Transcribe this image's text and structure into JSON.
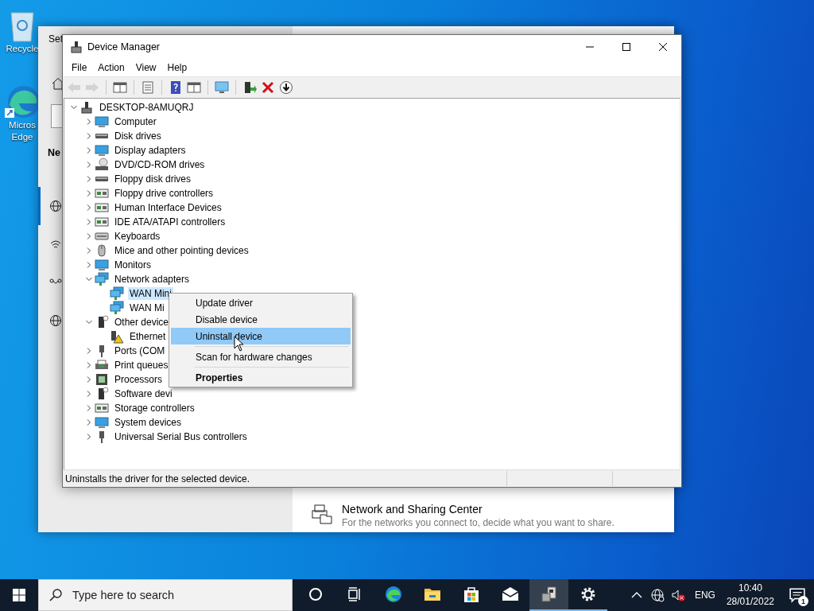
{
  "desktop_icons": [
    {
      "label_lines": [
        "Recycle"
      ]
    },
    {
      "label_lines": [
        "Micros",
        "Edge"
      ]
    }
  ],
  "settings_window": {
    "title": "Set",
    "heading": "Ne",
    "nav_items": [
      {
        "selected": true
      },
      {
        "selected": false
      },
      {
        "selected": false
      },
      {
        "selected": false
      }
    ],
    "link": {
      "title": "Network and Sharing Center",
      "description": "For the networks you connect to, decide what you want to share."
    }
  },
  "device_manager": {
    "title": "Device Manager",
    "menu": [
      "File",
      "Action",
      "View",
      "Help"
    ],
    "toolbar": [
      {
        "disabled": true
      },
      {
        "disabled": true
      },
      {
        "disabled": false
      },
      {
        "disabled": false
      },
      {
        "disabled": false
      },
      {
        "disabled": false
      },
      {
        "disabled": false
      },
      {
        "disabled": false
      },
      {
        "disabled": false
      },
      {
        "disabled": false
      }
    ],
    "tree": {
      "label": "DESKTOP-8AMUQRJ",
      "expanded": true,
      "selected": false,
      "children": [
        {
          "label": "Computer",
          "expanded": false,
          "selected": false
        },
        {
          "label": "Disk drives",
          "expanded": false,
          "selected": false
        },
        {
          "label": "Display adapters",
          "expanded": false,
          "selected": false
        },
        {
          "label": "DVD/CD-ROM drives",
          "expanded": false,
          "selected": false
        },
        {
          "label": "Floppy disk drives",
          "expanded": false,
          "selected": false
        },
        {
          "label": "Floppy drive controllers",
          "expanded": false,
          "selected": false
        },
        {
          "label": "Human Interface Devices",
          "expanded": false,
          "selected": false
        },
        {
          "label": "IDE ATA/ATAPI controllers",
          "expanded": false,
          "selected": false
        },
        {
          "label": "Keyboards",
          "expanded": false,
          "selected": false
        },
        {
          "label": "Mice and other pointing devices",
          "expanded": false,
          "selected": false
        },
        {
          "label": "Monitors",
          "expanded": false,
          "selected": false
        },
        {
          "label": "Network adapters",
          "expanded": true,
          "selected": false,
          "children": [
            {
              "label": "WAN Mini",
              "selected": true
            },
            {
              "label": "WAN Mi",
              "selected": false
            }
          ]
        },
        {
          "label": "Other device",
          "expanded": true,
          "selected": false,
          "children": [
            {
              "label": "Ethernet",
              "selected": false
            }
          ]
        },
        {
          "label": "Ports (COM",
          "expanded": false,
          "selected": false
        },
        {
          "label": "Print queues",
          "expanded": false,
          "selected": false
        },
        {
          "label": "Processors",
          "expanded": false,
          "selected": false
        },
        {
          "label": "Software devi",
          "expanded": false,
          "selected": false
        },
        {
          "label": "Storage controllers",
          "expanded": false,
          "selected": false
        },
        {
          "label": "System devices",
          "expanded": false,
          "selected": false
        },
        {
          "label": "Universal Serial Bus controllers",
          "expanded": false,
          "selected": false
        }
      ]
    },
    "status_bar": {
      "text": "Uninstalls the driver for the selected device."
    }
  },
  "context_menu": {
    "groups": [
      [
        {
          "label": "Update driver",
          "selected": false,
          "default": false
        },
        {
          "label": "Disable device",
          "selected": false,
          "default": false
        },
        {
          "label": "Uninstall device",
          "selected": true,
          "default": false
        }
      ],
      [
        {
          "label": "Scan for hardware changes",
          "selected": false,
          "default": false
        }
      ],
      [
        {
          "label": "Properties",
          "selected": false,
          "default": true
        }
      ]
    ]
  },
  "taskbar": {
    "search": {
      "placeholder": "Type here to search"
    },
    "apps": [
      {
        "running": false,
        "active": false
      },
      {
        "running": false,
        "active": false
      },
      {
        "running": false,
        "active": false
      },
      {
        "running": false,
        "active": false
      },
      {
        "running": false,
        "active": false
      },
      {
        "running": false,
        "active": false
      },
      {
        "running": true,
        "active": true
      },
      {
        "running": true,
        "active": false
      }
    ],
    "tray": {
      "language": "ENG",
      "time": "10:40",
      "date": "28/01/2022",
      "notifications": "1"
    }
  }
}
